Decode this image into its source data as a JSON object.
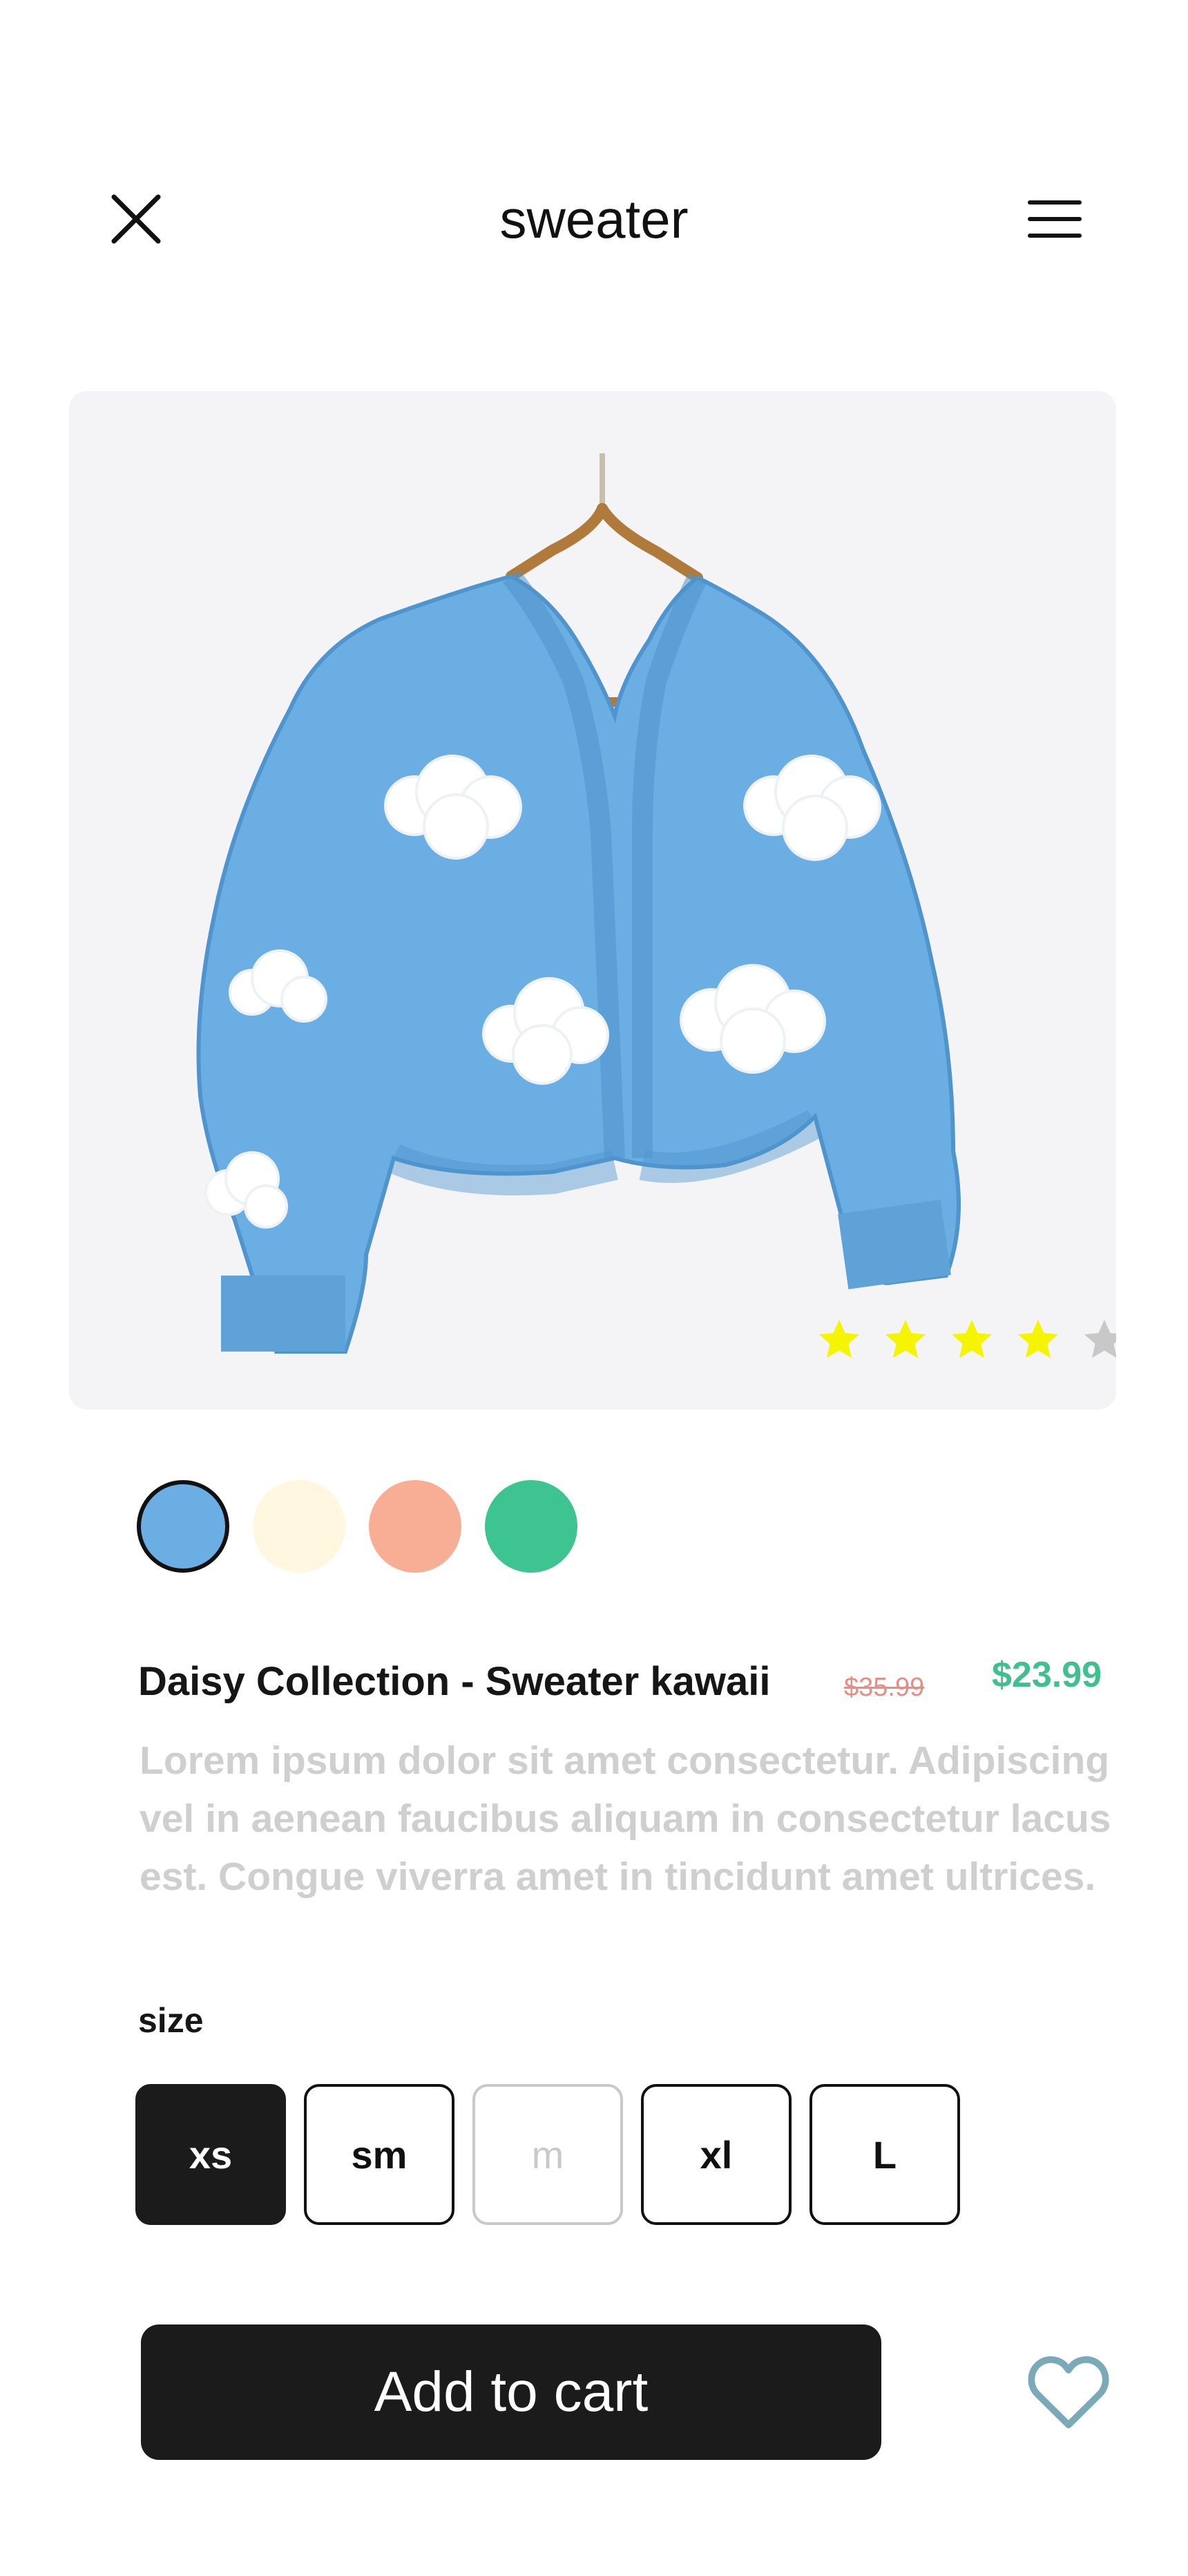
{
  "header": {
    "title": "sweater",
    "close_icon": "close-icon",
    "menu_icon": "hamburger-menu-icon"
  },
  "product": {
    "image_alt": "Blue knit cardigan with white cloud patches on a wooden hanger",
    "rating": 4,
    "rating_max": 5,
    "name": "Daisy Collection - Sweater kawaii",
    "old_price": "$35.99",
    "price": "$23.99",
    "description": "Lorem ipsum dolor sit amet consectetur. Adipiscing vel in aenean faucibus aliquam in consectetur lacus est. Congue viverra amet in tincidunt amet ultrices."
  },
  "colors": [
    {
      "name": "blue",
      "hex": "#6aaee3",
      "selected": true
    },
    {
      "name": "cream",
      "hex": "#fff7df",
      "selected": false
    },
    {
      "name": "peach",
      "hex": "#f7ae95",
      "selected": false
    },
    {
      "name": "green",
      "hex": "#3ec490",
      "selected": false
    }
  ],
  "size": {
    "label": "size",
    "options": [
      {
        "label": "xs",
        "state": "selected"
      },
      {
        "label": "sm",
        "state": "available"
      },
      {
        "label": "m",
        "state": "disabled"
      },
      {
        "label": "xl",
        "state": "available"
      },
      {
        "label": "L",
        "state": "available"
      }
    ]
  },
  "actions": {
    "add_to_cart": "Add to cart",
    "favorite_icon": "heart-icon"
  },
  "theme": {
    "star_active": "#f5f500",
    "star_inactive": "#c8c8c8",
    "price_color": "#3fc08e",
    "old_price_color": "#e98c84",
    "heart_color": "#7aa9b8"
  }
}
